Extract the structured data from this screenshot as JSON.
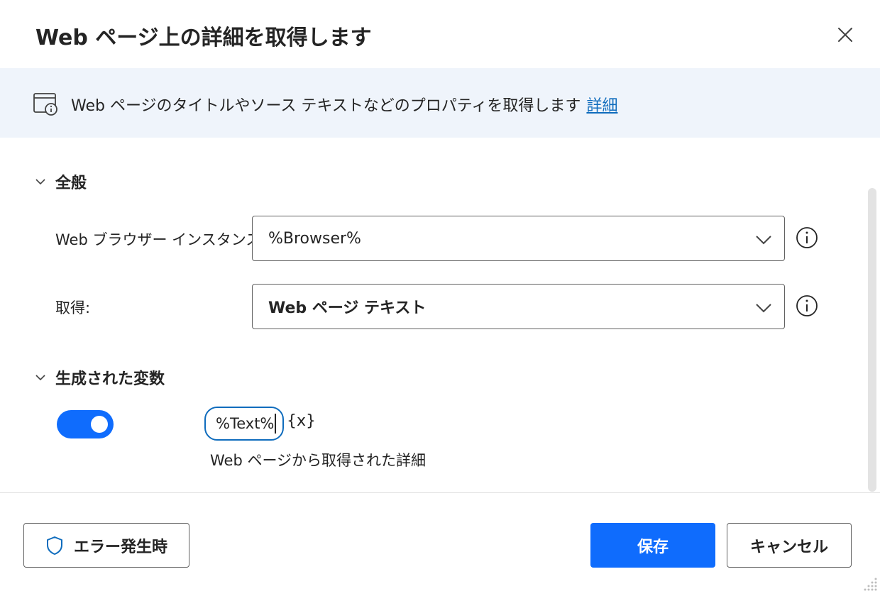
{
  "dialog": {
    "title": "Web ページ上の詳細を取得します"
  },
  "info": {
    "text": "Web ページのタイトルやソース テキストなどのプロパティを取得します",
    "link": "詳細"
  },
  "sections": {
    "general": "全般",
    "variables": "生成された変数"
  },
  "fields": {
    "browser_label": "Web ブラウザー インスタンス:",
    "browser_value": "%Browser%",
    "get_label": "取得:",
    "get_value": "Web ページ テキスト"
  },
  "variable": {
    "toggle_on": true,
    "name": "%Text%",
    "picker": "{x}",
    "description": "Web ページから取得された詳細"
  },
  "footer": {
    "on_error": "エラー発生時",
    "save": "保存",
    "cancel": "キャンセル"
  },
  "colors": {
    "accent": "#0f6cfd",
    "link": "#0f6cbd",
    "info_band": "#eff4fb"
  }
}
